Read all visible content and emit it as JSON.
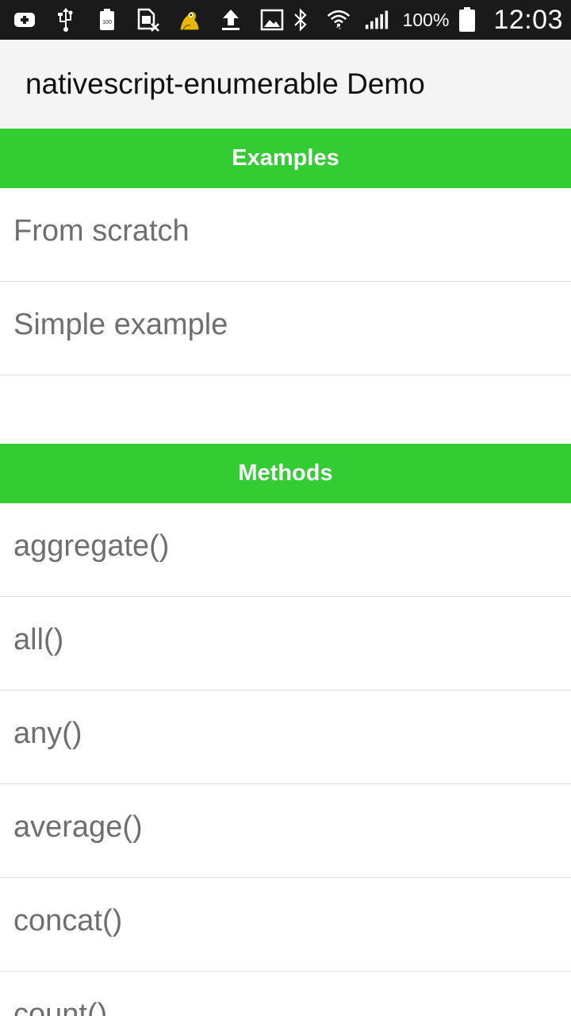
{
  "status_bar": {
    "battery_percent": "100%",
    "time": "12:03",
    "icons": [
      "add-icon",
      "usb-icon",
      "battery-100-icon",
      "sim-off-icon",
      "mascot-icon",
      "upload-icon",
      "image-icon",
      "bluetooth-icon",
      "wifi-icon",
      "signal-icon",
      "battery-icon"
    ]
  },
  "app_bar": {
    "title": "nativescript-enumerable Demo"
  },
  "sections": {
    "examples": {
      "header": "Examples",
      "items": [
        "From scratch",
        "Simple example"
      ]
    },
    "methods": {
      "header": "Methods",
      "items": [
        "aggregate()",
        "all()",
        "any()",
        "average()",
        "concat()",
        "count()"
      ]
    }
  },
  "colors": {
    "accent": "#33cc33",
    "status_bar": "#1a1a1a",
    "action_bar": "#f4f4f4",
    "item_text": "#6f6f6f"
  }
}
